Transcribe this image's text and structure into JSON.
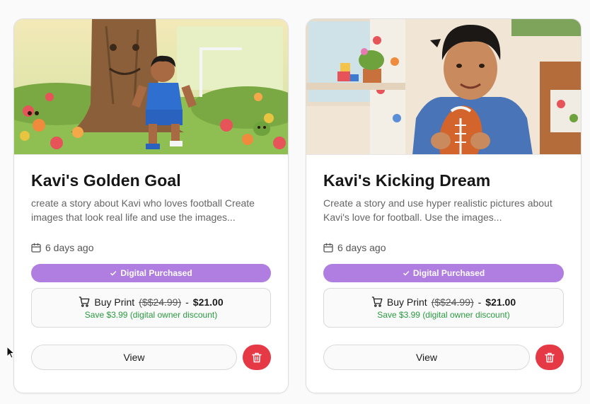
{
  "cards": [
    {
      "title": "Kavi's Golden Goal",
      "description": "create a story about Kavi who loves football Create images that look real life and use the images...",
      "date": "6 days ago",
      "badge": "Digital Purchased",
      "buy_label": "Buy Print",
      "old_price": "($$24.99)",
      "separator": "-",
      "new_price": "$21.00",
      "save_note": "Save $3.99 (digital owner discount)",
      "view_label": "View",
      "image_icon": "illustration-boy-kicking-ball-icon"
    },
    {
      "title": "Kavi's Kicking Dream",
      "description": "Create a story and use hyper realistic pictures about Kavi's love for football. Use the images...",
      "date": "6 days ago",
      "badge": "Digital Purchased",
      "buy_label": "Buy Print",
      "old_price": "($$24.99)",
      "separator": "-",
      "new_price": "$21.00",
      "save_note": "Save $3.99 (digital owner discount)",
      "view_label": "View",
      "image_icon": "illustration-boy-holding-ball-icon"
    }
  ],
  "colors": {
    "badge": "#b07de0",
    "delete": "#e53945",
    "save_text": "#2a9a3f"
  }
}
